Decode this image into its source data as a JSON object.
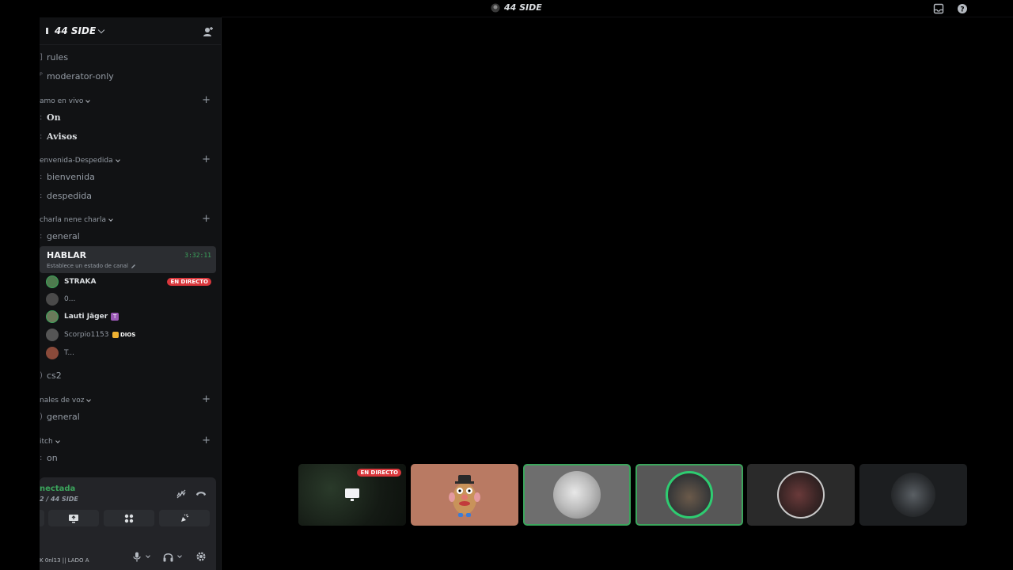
{
  "window": {
    "title": "44 SIDE"
  },
  "server": {
    "name": "44 SIDE"
  },
  "channels": [
    {
      "name": "rules"
    },
    {
      "name": "moderator-only"
    }
  ],
  "categories": [
    {
      "label": "amo en vivo",
      "channels": [
        {
          "name": "On"
        },
        {
          "name": "Avisos"
        }
      ]
    },
    {
      "label": "envenida-Despedida",
      "channels": [
        {
          "name": "bienvenida"
        },
        {
          "name": "despedida"
        }
      ]
    },
    {
      "label": "charla nene charla",
      "channels": [
        {
          "name": "general"
        }
      ]
    },
    {
      "label": "nales de voz",
      "channels": [
        {
          "name": "general"
        }
      ]
    },
    {
      "label": "itch",
      "channels": [
        {
          "name": "on"
        }
      ]
    }
  ],
  "voice_channel": {
    "name": "HABLAR",
    "timer": "3:32:11",
    "status_placeholder": "Establece un estado de canal",
    "members": [
      {
        "name": "STRAKA",
        "badge": "EN DIRECTO"
      },
      {
        "name": "0..."
      },
      {
        "name": "Lauti Jäger",
        "booster": "T"
      },
      {
        "name": "Scorpio1153",
        "tag": "DIOS"
      },
      {
        "name": "T..."
      }
    ]
  },
  "extra_channel": {
    "name": "cs2"
  },
  "user_panel": {
    "connection_status": "nectada",
    "connection_sub": "2 / 44 SIDE",
    "username": "K 0nl13 || LADO A"
  },
  "video_strip": {
    "live_badge": "EN DIRECTO",
    "tiles": [
      {
        "label": "screen-share-tile",
        "bg": "#1b2118"
      },
      {
        "label": "mr-potato-head-tile",
        "bg": "#b97a63"
      },
      {
        "label": "cat-tile",
        "bg": "#6e6e6e"
      },
      {
        "label": "user-avatar-tile",
        "bg": "#575757"
      },
      {
        "label": "red-avatar-tile",
        "bg": "#2a2a2a"
      },
      {
        "label": "soldiers-avatar-tile",
        "bg": "#1c1e20"
      }
    ]
  },
  "colors": {
    "accent_green": "#3ba55c",
    "live_red": "#da373c"
  }
}
